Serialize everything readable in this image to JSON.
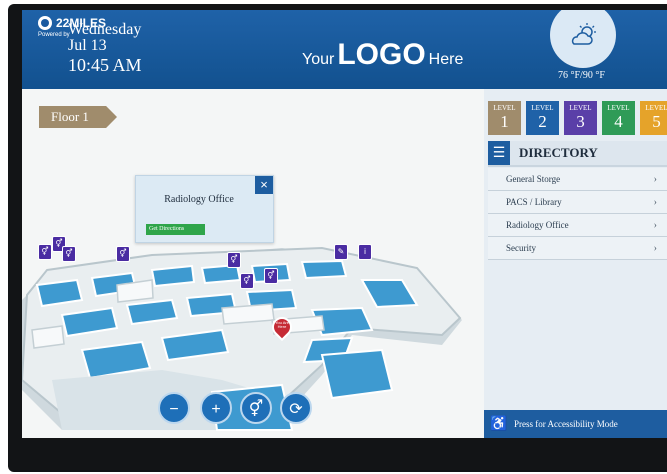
{
  "header": {
    "brand": "22MILES",
    "brand_sub": "Powered by",
    "weekday": "Wednesday",
    "date": "Jul 13",
    "time": "10:45 AM",
    "logo_prefix": "Your",
    "logo_main": "LOGO",
    "logo_suffix": "Here",
    "temps": "76 °F/90 °F",
    "weather_icon": "partly-cloudy-icon"
  },
  "map": {
    "floor_label": "Floor 1",
    "popup": {
      "title": "Radiology Office",
      "button": "Get Directions"
    },
    "marker": "You Are Here",
    "controls": [
      "zoom-out-icon",
      "zoom-in-icon",
      "restroom-icon",
      "reset-icon"
    ]
  },
  "panel": {
    "levels": [
      {
        "label": "LEVEL",
        "number": "1",
        "color": "#a08c6c"
      },
      {
        "label": "LEVEL",
        "number": "2",
        "color": "#1f62a8"
      },
      {
        "label": "LEVEL",
        "number": "3",
        "color": "#5a3fa8"
      },
      {
        "label": "LEVEL",
        "number": "4",
        "color": "#2f9b57"
      },
      {
        "label": "LEVEL",
        "number": "5",
        "color": "#e5a32a"
      }
    ],
    "directory_title": "DIRECTORY",
    "items": [
      {
        "label": "General Storge"
      },
      {
        "label": "PACS / Library"
      },
      {
        "label": "Radiology Office"
      },
      {
        "label": "Security"
      }
    ],
    "accessibility": "Press for Accessibility Mode"
  },
  "colors": {
    "header": "#1f62a8",
    "accent": "#1d5da0",
    "pin": "#c62b35",
    "poi": "#4a2ca2"
  }
}
